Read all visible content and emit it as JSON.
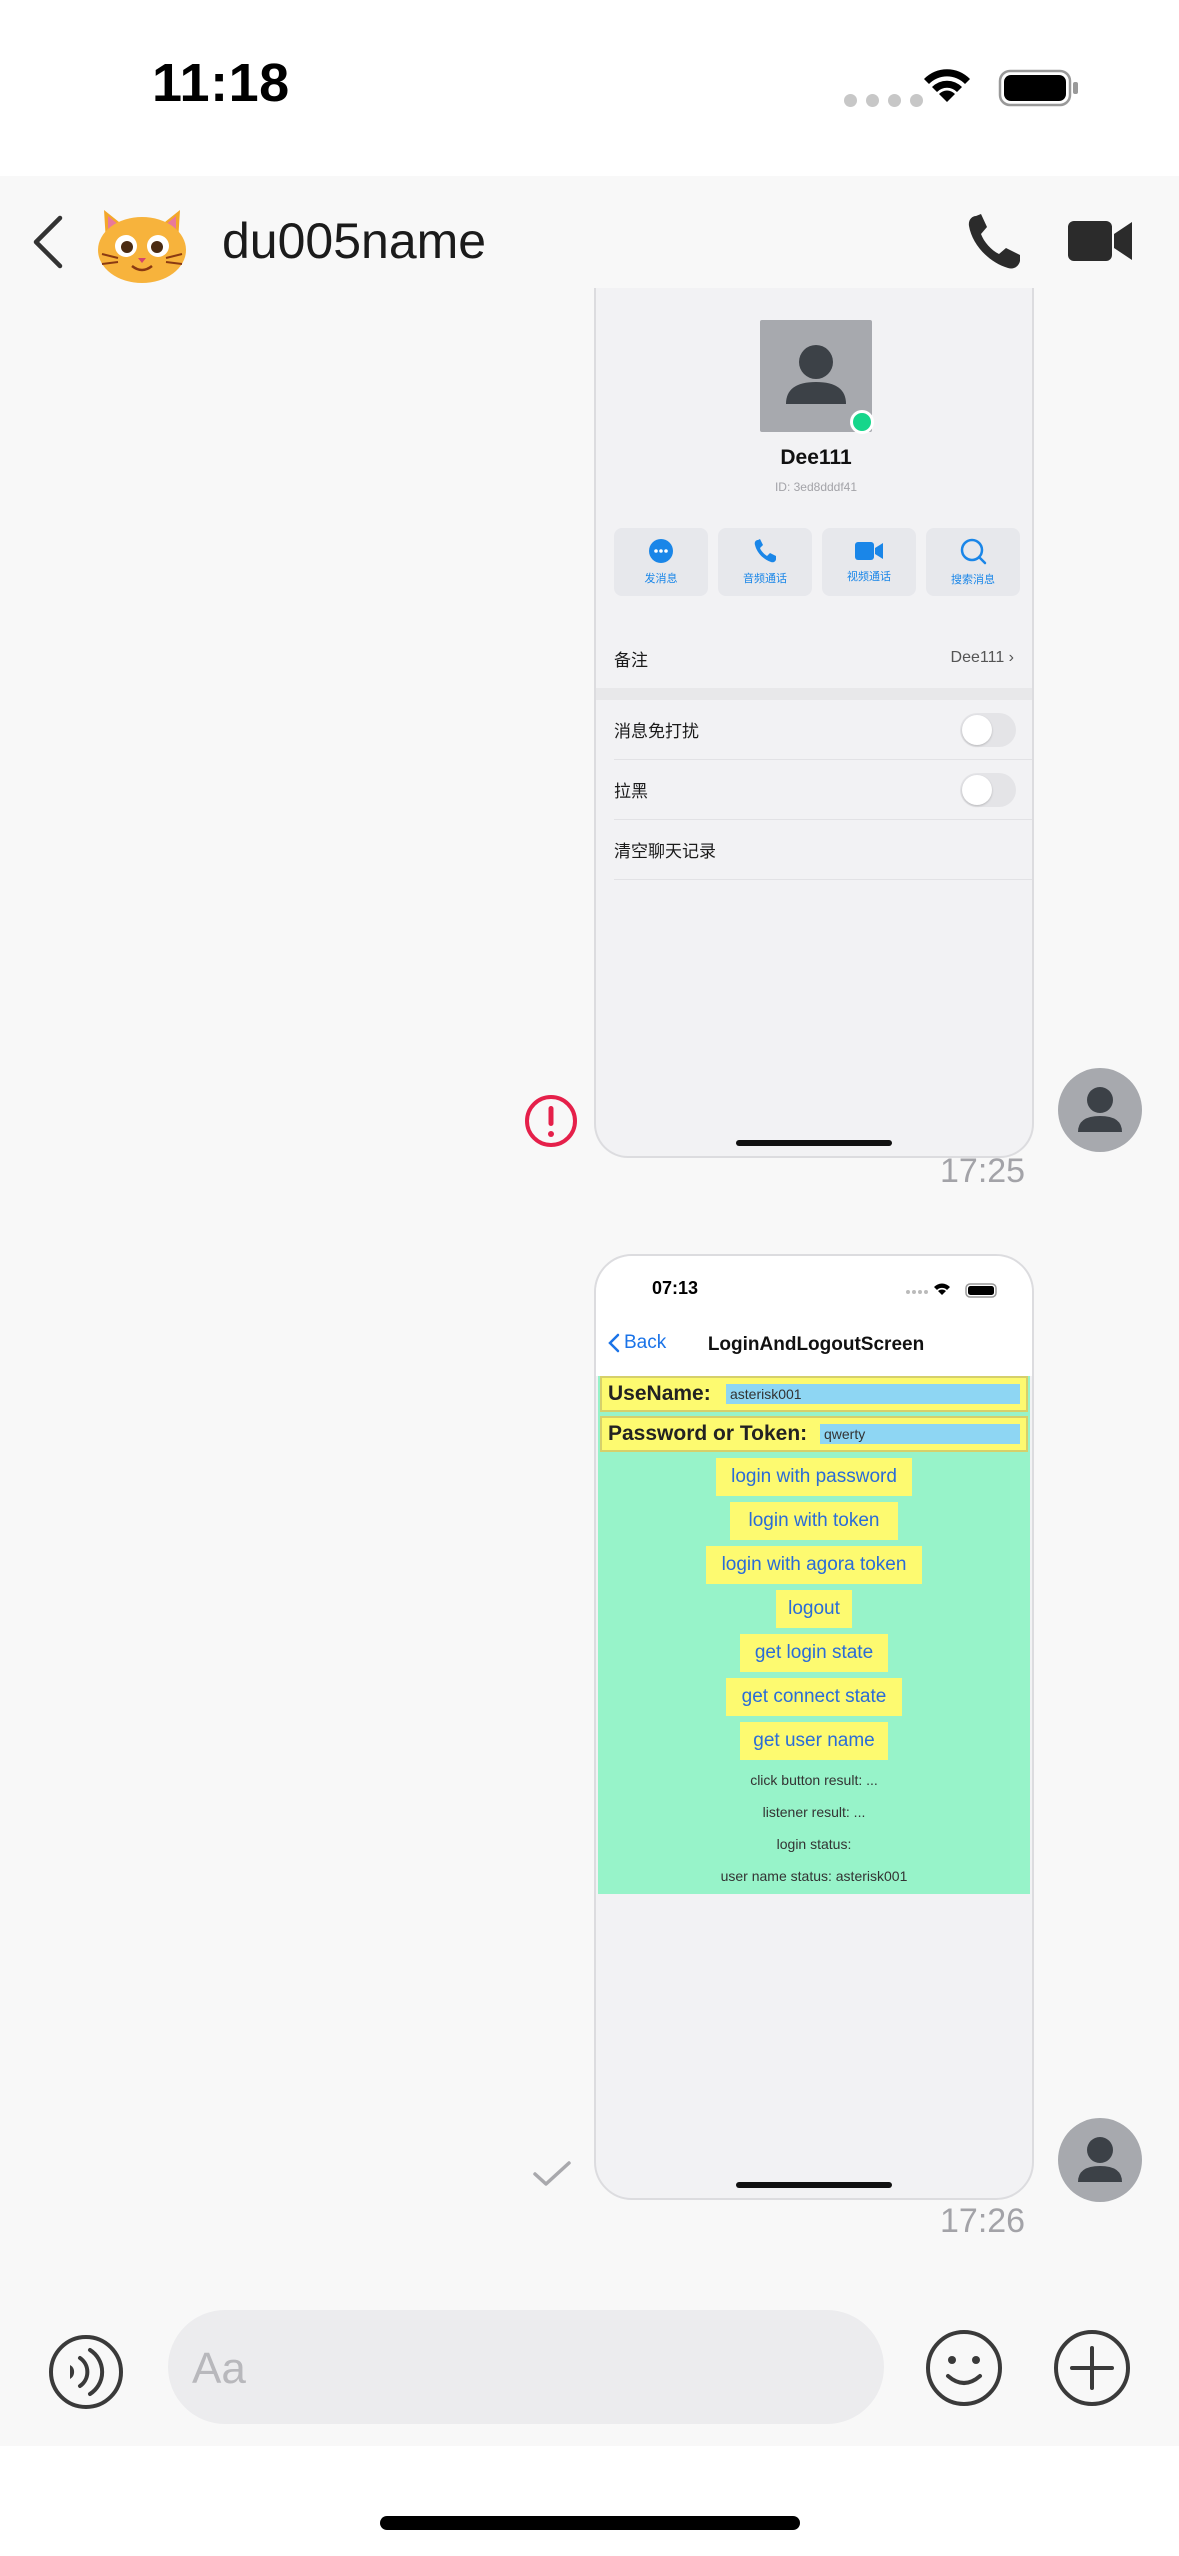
{
  "status_bar": {
    "time": "11:18"
  },
  "header": {
    "contact_name": "du005name"
  },
  "messages": [
    {
      "type": "image",
      "time": "17:25",
      "status": "failed",
      "screenshot": {
        "name": "Dee111",
        "id": "ID: 3ed8dddf41",
        "actions": [
          "发消息",
          "音频通话",
          "视频通话",
          "搜索消息"
        ],
        "remark_label": "备注",
        "remark_value": "Dee111",
        "settings": [
          "消息免打扰",
          "拉黑",
          "清空聊天记录"
        ]
      }
    },
    {
      "type": "image",
      "time": "17:26",
      "status": "sent",
      "screenshot": {
        "time": "07:13",
        "back_label": "Back",
        "title": "LoginAndLogoutScreen",
        "username_label": "UseName:",
        "username_value": "asterisk001",
        "password_label": "Password or Token:",
        "password_value": "qwerty",
        "buttons": [
          "login with password",
          "login with token",
          "login with agora token",
          "logout",
          "get login state",
          "get connect state",
          "get user name"
        ],
        "notes": [
          "click button result: ...",
          "listener result: ...",
          "login status:",
          "user name status: asterisk001"
        ]
      }
    }
  ],
  "composer": {
    "placeholder": "Aa"
  },
  "colors": {
    "error": "#e5204a",
    "accent": "#1a73e8",
    "green_panel": "#97f3c9",
    "yellow": "#fdfa70"
  }
}
